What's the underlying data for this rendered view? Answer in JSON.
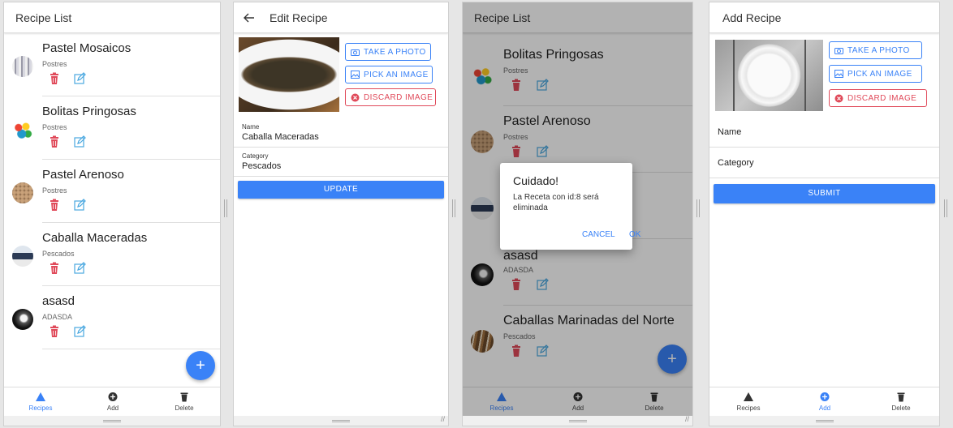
{
  "panel1": {
    "title": "Recipe List",
    "items": [
      {
        "title": "Pastel Mosaicos",
        "category": "Postres"
      },
      {
        "title": "Bolitas Pringosas",
        "category": "Postres"
      },
      {
        "title": "Pastel Arenoso",
        "category": "Postres"
      },
      {
        "title": "Caballa Maceradas",
        "category": "Pescados"
      },
      {
        "title": "asasd",
        "category": "ADASDA"
      }
    ],
    "fab_label": "+",
    "tabs": [
      {
        "label": "Recipes"
      },
      {
        "label": "Add"
      },
      {
        "label": "Delete"
      }
    ]
  },
  "panel2": {
    "title": "Edit Recipe",
    "take_photo": "TAKE A PHOTO",
    "pick_image": "PICK AN IMAGE",
    "discard_image": "DISCARD IMAGE",
    "name_label": "Name",
    "name_value": "Caballa Maceradas",
    "category_label": "Category",
    "category_value": "Pescados",
    "update_label": "UPDATE"
  },
  "panel3": {
    "title": "Recipe List",
    "items": [
      {
        "title": "Bolitas Pringosas",
        "category": "Postres"
      },
      {
        "title": "Pastel Arenoso",
        "category": "Postres"
      },
      {
        "title": "",
        "category": ""
      },
      {
        "title": "asasd",
        "category": "ADASDA"
      },
      {
        "title": "Caballas Marinadas del Norte",
        "category": "Pescados"
      }
    ],
    "dialog": {
      "title": "Cuidado!",
      "message": "La Receta con id:8 será eliminada",
      "cancel": "CANCEL",
      "ok": "OK"
    },
    "fab_label": "+",
    "tabs": [
      {
        "label": "Recipes"
      },
      {
        "label": "Add"
      },
      {
        "label": "Delete"
      }
    ]
  },
  "panel4": {
    "title": "Add Recipe",
    "take_photo": "TAKE A PHOTO",
    "pick_image": "PICK AN IMAGE",
    "discard_image": "DISCARD IMAGE",
    "name_label": "Name",
    "category_label": "Category",
    "submit_label": "SUBMIT",
    "tabs": [
      {
        "label": "Recipes"
      },
      {
        "label": "Add"
      },
      {
        "label": "Delete"
      }
    ]
  },
  "colors": {
    "accent": "#3a82f7",
    "danger": "#e04a5a",
    "edit": "#4aa8e0"
  }
}
